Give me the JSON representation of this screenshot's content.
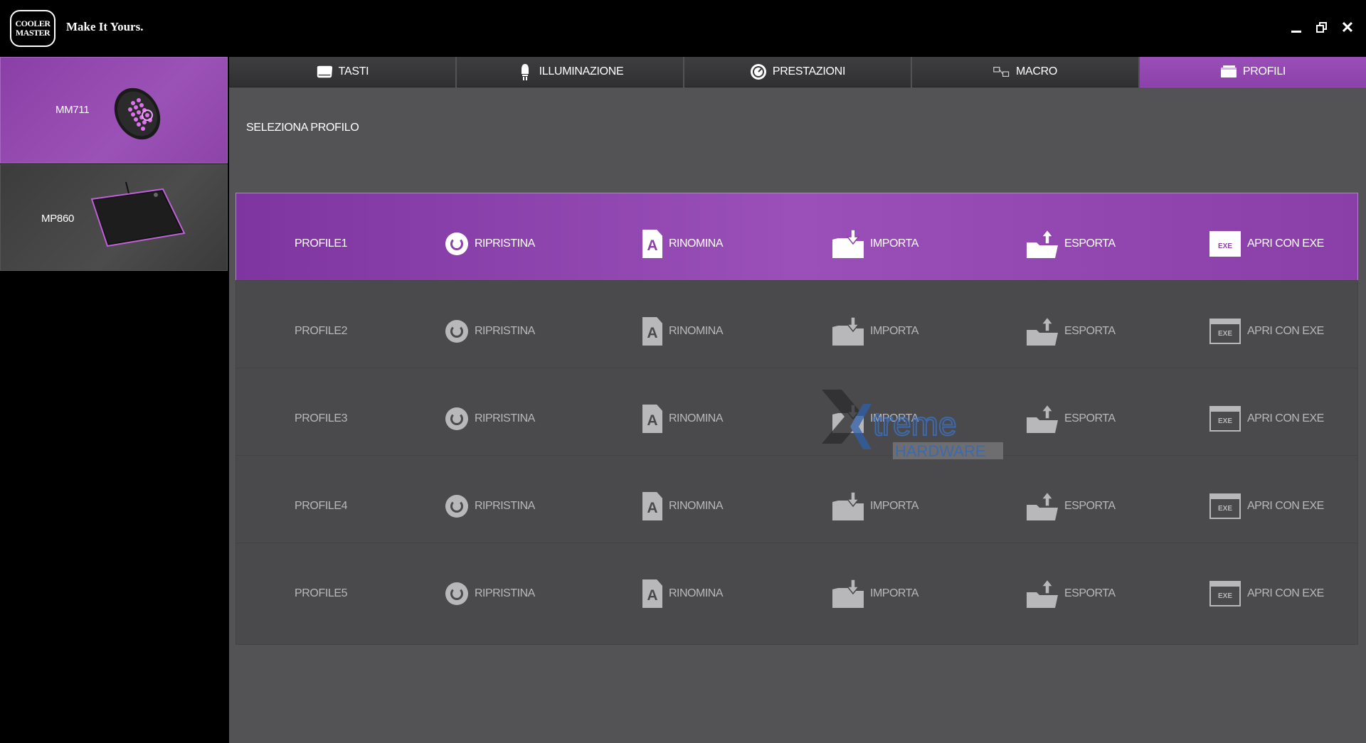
{
  "app": {
    "logo_line1": "COOLER",
    "logo_line2": "MASTER",
    "tagline": "Make It Yours."
  },
  "devices": [
    {
      "name": "MM711",
      "selected": true
    },
    {
      "name": "MP860",
      "selected": false
    }
  ],
  "tabs": [
    {
      "label": "TASTI",
      "icon": "keyboard-icon",
      "active": false
    },
    {
      "label": "ILLUMINAZIONE",
      "icon": "light-bulb-icon",
      "active": false
    },
    {
      "label": "PRESTAZIONI",
      "icon": "speedometer-icon",
      "active": false
    },
    {
      "label": "MACRO",
      "icon": "macro-icon",
      "active": false
    },
    {
      "label": "PROFILI",
      "icon": "profile-card-icon",
      "active": true
    }
  ],
  "section_title": "SELEZIONA PROFILO",
  "actions": {
    "reset": "RIPRISTINA",
    "rename": "RINOMINA",
    "import": "IMPORTA",
    "export": "ESPORTA",
    "open_exe": "APRI CON EXE",
    "exe_icon_text": "EXE"
  },
  "profiles": [
    {
      "name": "PROFILE1",
      "active": true
    },
    {
      "name": "PROFILE2",
      "active": false
    },
    {
      "name": "PROFILE3",
      "active": false
    },
    {
      "name": "PROFILE4",
      "active": false
    },
    {
      "name": "PROFILE5",
      "active": false
    }
  ],
  "watermark": {
    "line1": "treme",
    "line2": "HARDWARE"
  },
  "colors": {
    "accent": "#9a4fb8",
    "panel": "#535356",
    "row": "#4a4a4d"
  }
}
